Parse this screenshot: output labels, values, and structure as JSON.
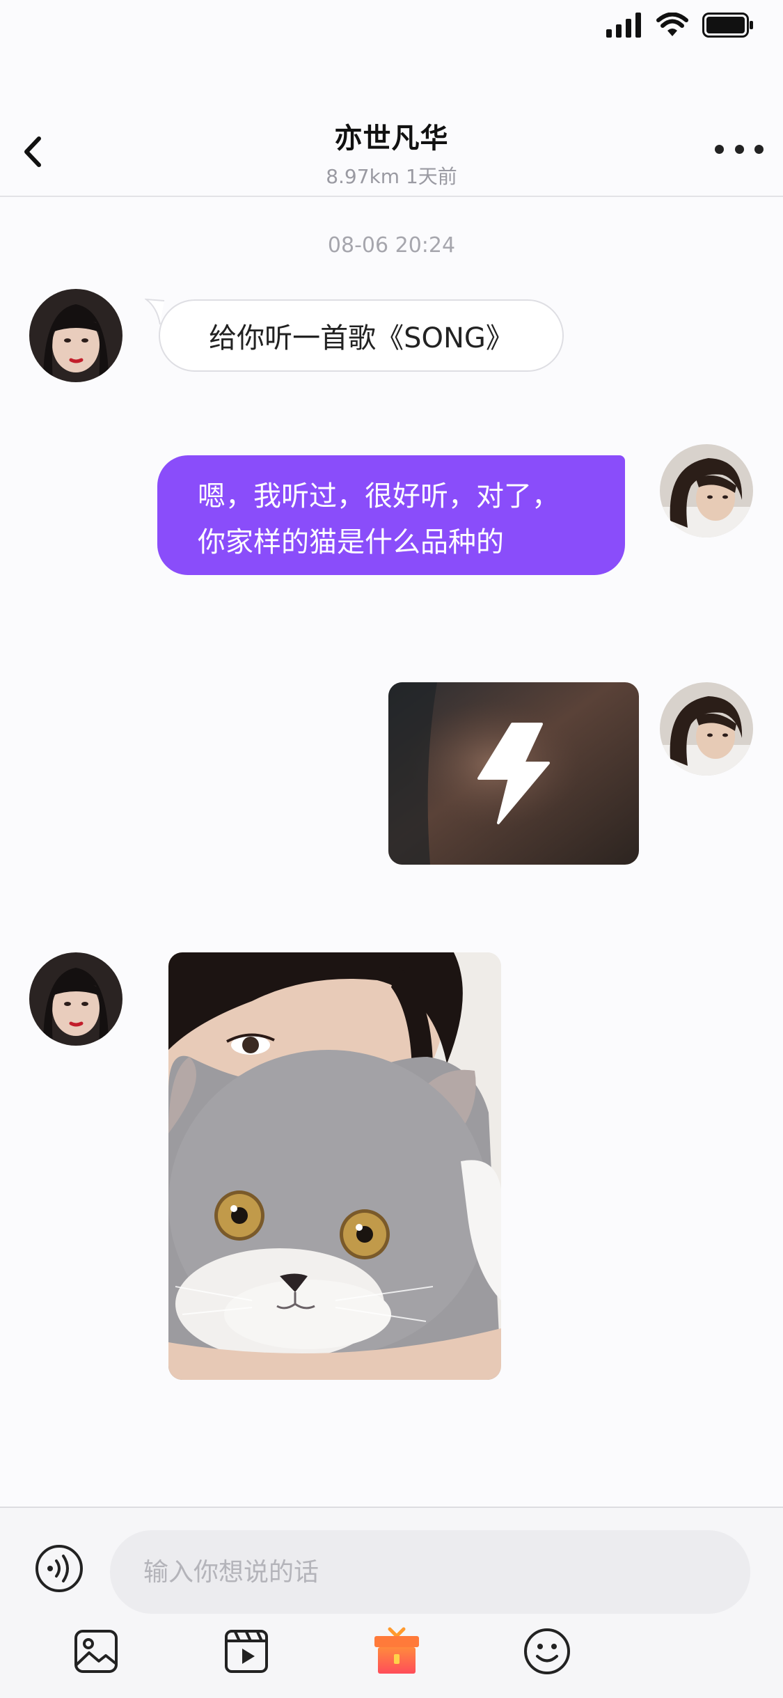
{
  "header": {
    "title": "亦世凡华",
    "subtitle": "8.97km  1天前"
  },
  "chat": {
    "timestamp": "08-06 20:24",
    "messages": [
      {
        "side": "incoming",
        "type": "text",
        "text": "给你听一首歌《SONG》"
      },
      {
        "side": "outgoing",
        "type": "text",
        "lines": [
          "嗯，我听过，很好听，对了，",
          "你家样的猫是什么品种的"
        ]
      },
      {
        "side": "outgoing",
        "type": "flash-media",
        "icon": "lightning-icon"
      },
      {
        "side": "incoming",
        "type": "photo",
        "description_icon": "cat-photo"
      }
    ]
  },
  "input": {
    "placeholder": "输入你想说的话"
  },
  "toolbar": {
    "items": [
      "image-icon",
      "video-icon",
      "gift-icon",
      "emoji-icon"
    ]
  },
  "colors": {
    "accent_purple": "#8a4dfa",
    "background": "#fbfbfd",
    "gift_orange": "#ff6b3d"
  }
}
